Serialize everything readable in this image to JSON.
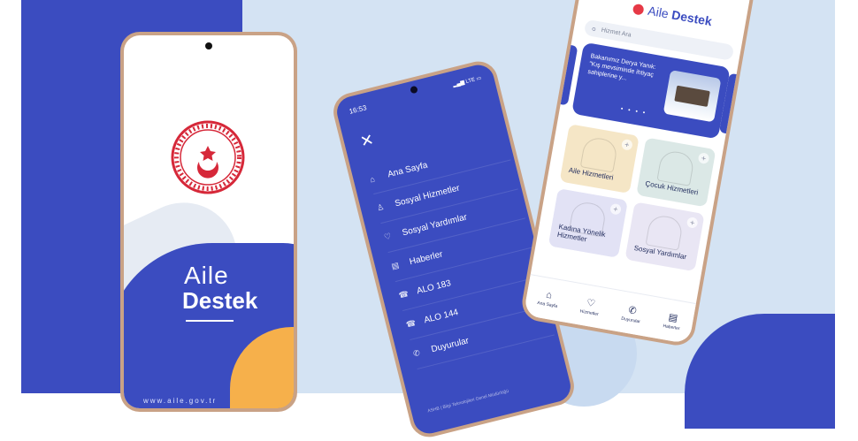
{
  "colors": {
    "brand_blue": "#3b4cc0",
    "accent_orange": "#f6b04b",
    "background": "#d4e3f3",
    "card_family": "#f5e6c6",
    "card_child": "#dbe8e6",
    "card_women": "#e2e2f5",
    "card_social": "#e9e6f4"
  },
  "splash": {
    "logo_line1": "Aile",
    "logo_line2": "Destek",
    "url": "www.aile.gov.tr",
    "seal_icon": "ministry-seal-icon"
  },
  "menu_screen": {
    "time": "16:53",
    "status": "LTE",
    "close_icon": "close-icon",
    "items": [
      {
        "label": "Ana Sayfa",
        "icon": "home-icon"
      },
      {
        "label": "Sosyal Hizmetler",
        "icon": "people-icon"
      },
      {
        "label": "Sosyal Yardımlar",
        "icon": "hand-heart-icon"
      },
      {
        "label": "Haberler",
        "icon": "news-icon"
      },
      {
        "label": "ALO 183",
        "icon": "phone-icon"
      },
      {
        "label": "ALO 144",
        "icon": "phone-icon"
      },
      {
        "label": "Duyurular",
        "icon": "megaphone-icon"
      }
    ],
    "footer": "ASHB | Bilgi Teknolojileri Genel Müdürlüğü"
  },
  "home_screen": {
    "logo_line1": "Aile",
    "logo_line2": "Destek",
    "search_placeholder": "Hizmet Ara",
    "banner_text": "Bakanımız Derya Yanık: \"Kış mevsiminde ihtiyaç sahiplerine y...",
    "banner_dots": "• • • •",
    "cards": [
      {
        "label": "Aile Hizmetleri"
      },
      {
        "label": "Çocuk Hizmetleri"
      },
      {
        "label": "Kadına Yönelik Hizmetler"
      },
      {
        "label": "Sosyal Yardımlar"
      }
    ],
    "tabs": [
      {
        "label": "Ana Sayfa",
        "icon": "home-icon"
      },
      {
        "label": "Hizmetler",
        "icon": "hand-heart-icon"
      },
      {
        "label": "Duyurular",
        "icon": "megaphone-icon"
      },
      {
        "label": "Haberler",
        "icon": "news-icon"
      }
    ]
  }
}
